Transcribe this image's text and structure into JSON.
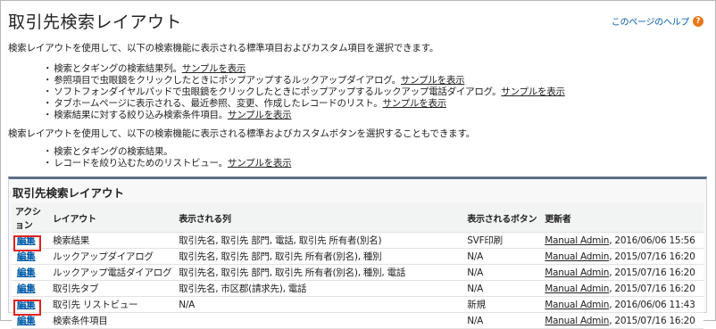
{
  "header": {
    "title": "取引先検索レイアウト",
    "help_link": "このページのヘルプ",
    "help_icon": "question-icon"
  },
  "intro1": "検索レイアウトを使用して、以下の検索機能に表示される標準項目およびカスタム項目を選択できます。",
  "bullets1": [
    {
      "text": "検索とタギングの検索結果列。",
      "link": "サンプルを表示"
    },
    {
      "text": "参照項目で虫眼鏡をクリックしたときにポップアップするルックアップダイアログ。",
      "link": "サンプルを表示"
    },
    {
      "text": "ソフトフォンダイヤルパッドで虫眼鏡をクリックしたときにポップアップするルックアップ電話ダイアログ。",
      "link": "サンプルを表示"
    },
    {
      "text": "タブホームページに表示される、最近参照、変更、作成したレコードのリスト。",
      "link": "サンプルを表示"
    },
    {
      "text": "検索結果に対する絞り込み検索条件項目。",
      "link": "サンプルを表示"
    }
  ],
  "intro2": "検索レイアウトを使用して、以下の検索機能に表示される標準およびカスタムボタンを選択することもできます。",
  "bullets2": [
    {
      "text": "検索とタギングの検索結果。",
      "link": ""
    },
    {
      "text": "レコードを絞り込むためのリストビュー。",
      "link": "サンプルを表示"
    }
  ],
  "list": {
    "title": "取引先検索レイアウト",
    "columns": [
      "アクション",
      "レイアウト",
      "表示される列",
      "表示されるボタン",
      "更新者"
    ],
    "rows": [
      {
        "action": "編集",
        "layout": "検索結果",
        "fields": "取引先名, 取引先 部門, 電話, 取引先 所有者(別名)",
        "buttons": "SVF印刷",
        "modified_by": "Manual Admin",
        "modified_at": ", 2016/06/06 15:56",
        "highlighted": true
      },
      {
        "action": "編集",
        "layout": "ルックアップダイアログ",
        "fields": "取引先名, 取引先 部門, 取引先 所有者(別名), 種別",
        "buttons": "N/A",
        "modified_by": "Manual Admin",
        "modified_at": ", 2015/07/16 16:20",
        "highlighted": false
      },
      {
        "action": "編集",
        "layout": "ルックアップ電話ダイアログ",
        "fields": "取引先名, 取引先 部門, 取引先 所有者(別名), 種別, 電話",
        "buttons": "N/A",
        "modified_by": "Manual Admin",
        "modified_at": ", 2015/07/16 16:20",
        "highlighted": false
      },
      {
        "action": "編集",
        "layout": "取引先タブ",
        "fields": "取引先名, 市区郡(請求先), 電話",
        "buttons": "N/A",
        "modified_by": "Manual Admin",
        "modified_at": ", 2015/07/16 16:20",
        "highlighted": false
      },
      {
        "action": "編集",
        "layout": "取引先 リストビュー",
        "fields": "N/A",
        "buttons": "新規",
        "modified_by": "Manual Admin",
        "modified_at": ", 2016/06/06 11:43",
        "highlighted": true
      },
      {
        "action": "編集",
        "layout": "検索条件項目",
        "fields": "",
        "buttons": "N/A",
        "modified_by": "Manual Admin",
        "modified_at": ", 2015/07/16 16:20",
        "highlighted": false
      }
    ]
  },
  "colors": {
    "link": "#015ba7",
    "highlight": "#e02020",
    "header_bar": "#5f6e86",
    "help_icon": "#e87818"
  }
}
